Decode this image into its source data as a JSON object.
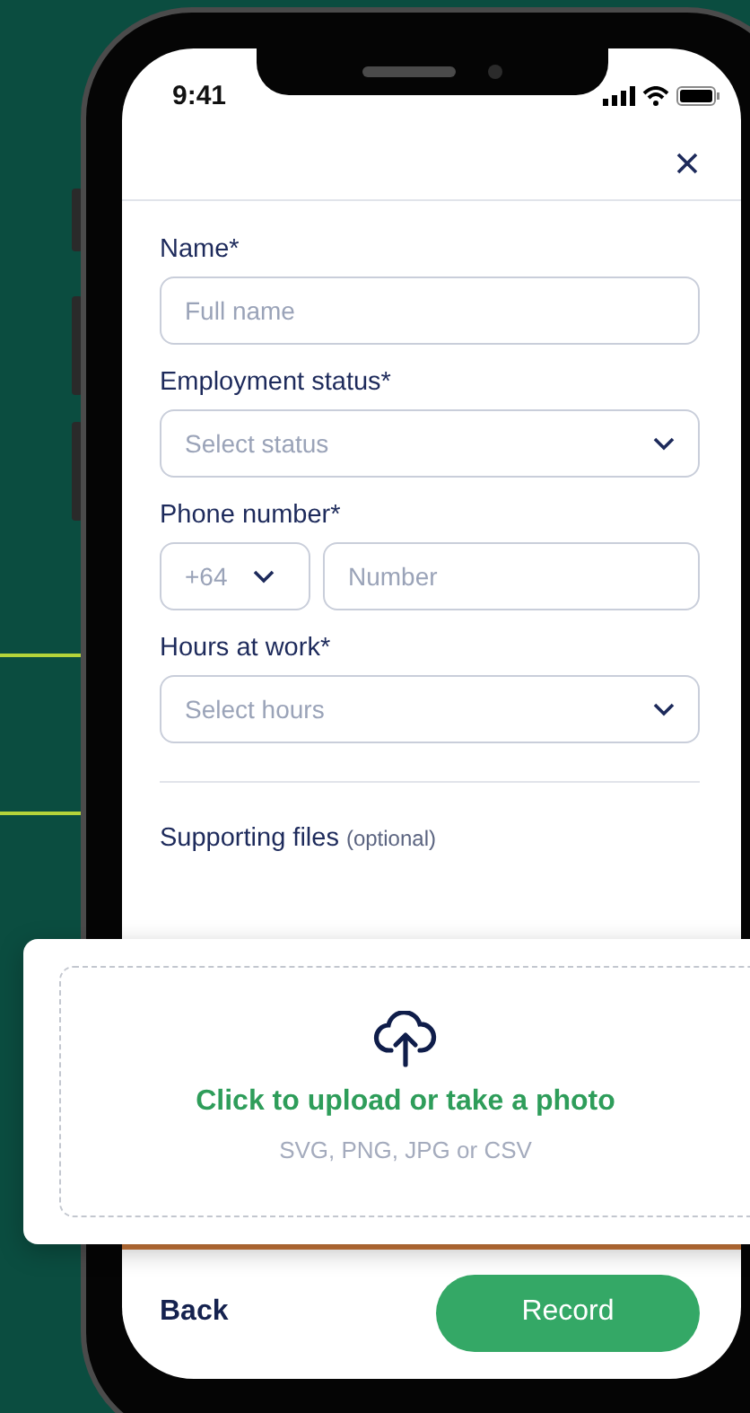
{
  "status_bar": {
    "time": "9:41"
  },
  "form": {
    "fields": [
      {
        "kind": "text",
        "label": "Name*",
        "placeholder": "Full name"
      },
      {
        "kind": "select",
        "label": "Employment status*",
        "placeholder": "Select status"
      },
      {
        "kind": "phone",
        "label": "Phone number*",
        "country_code": "+64",
        "placeholder": "Number"
      },
      {
        "kind": "select",
        "label": "Hours at work*",
        "placeholder": "Select hours"
      }
    ]
  },
  "supporting_files": {
    "label": "Supporting files",
    "hint": "(optional)"
  },
  "upload": {
    "title": "Click to upload or take a photo",
    "formats": "SVG, PNG, JPG or CSV"
  },
  "footer": {
    "back": "Back",
    "primary": "Record"
  }
}
